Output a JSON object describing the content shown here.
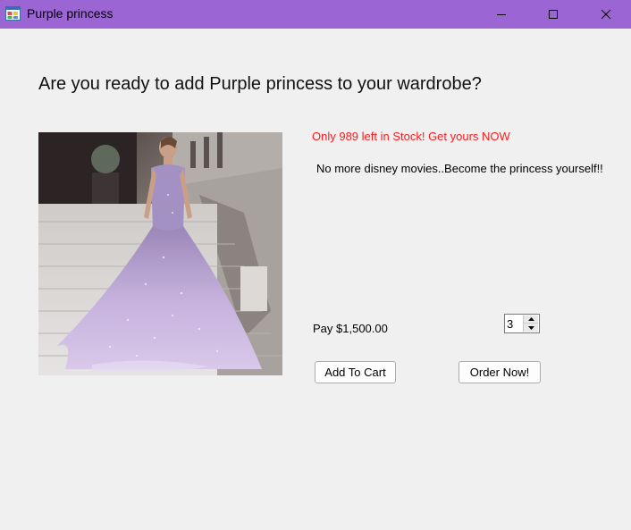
{
  "window": {
    "title": "Purple princess",
    "titlebar_color": "#9b66d4",
    "icons": {
      "app": "windows-form-icon",
      "minimize": "minimize-icon",
      "maximize": "maximize-icon",
      "close": "close-icon"
    }
  },
  "main": {
    "heading": "Are you ready to add Purple princess to your wardrobe?",
    "stock_message": "Only 989 left in Stock! Get yours NOW",
    "stock_color": "#ff1a1a",
    "tagline": "No more disney movies..Become the princess yourself!!",
    "price": "Pay $1,500.00",
    "quantity": "3",
    "buttons": {
      "add_to_cart": "Add To Cart",
      "order_now": "Order Now!"
    },
    "image": "purple-ball-gown-photo"
  }
}
